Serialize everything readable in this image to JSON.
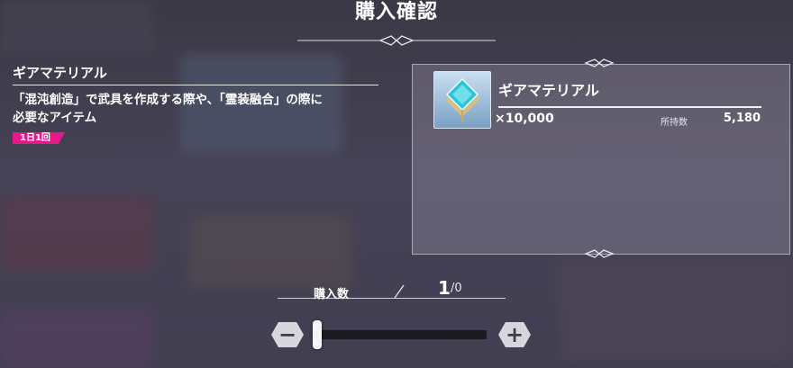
{
  "dialog": {
    "title": "購入確認"
  },
  "item": {
    "name": "ギアマテリアル",
    "description_lines": [
      "「混沌創造」で武具を作成する際や、「霊装融合」の際に",
      "必要なアイテム"
    ],
    "limit_badge": "1日1回",
    "quantity": "×10,000",
    "owned_label": "所持数",
    "owned_value": "5,180",
    "icon": "gem-diamond-icon"
  },
  "purchase": {
    "label": "購入数",
    "current": "1",
    "max": "/0",
    "slider_fraction": 0
  },
  "colors": {
    "badge": "#e6198a",
    "track": "#1b1a20",
    "button": "#d8d6dc"
  },
  "buttons": {
    "minus_icon": "minus-icon",
    "plus_icon": "plus-icon"
  }
}
